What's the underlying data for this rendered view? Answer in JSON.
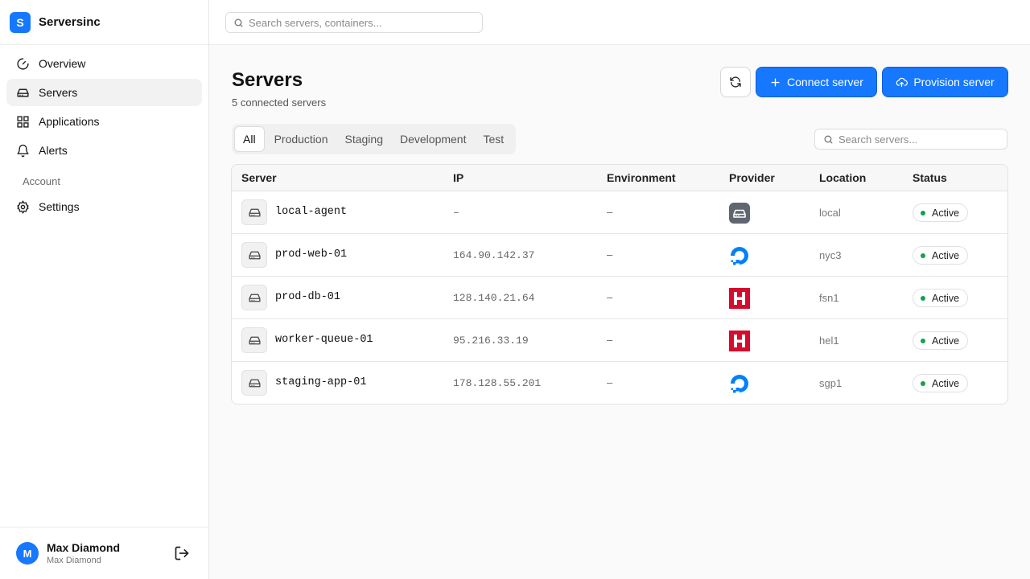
{
  "app": {
    "name": "Serversinc",
    "logo_letter": "S"
  },
  "sidebar": {
    "items": [
      {
        "label": "Overview",
        "icon": "gauge-icon"
      },
      {
        "label": "Servers",
        "icon": "hard-drive-icon"
      },
      {
        "label": "Applications",
        "icon": "grid-icon"
      },
      {
        "label": "Alerts",
        "icon": "bell-icon"
      }
    ],
    "account_label": "Account",
    "account_items": [
      {
        "label": "Settings",
        "icon": "gear-icon"
      }
    ]
  },
  "user": {
    "initial": "M",
    "name": "Max Diamond",
    "subtitle": "Max Diamond"
  },
  "topbar": {
    "search_placeholder": "Search servers, containers..."
  },
  "page": {
    "title": "Servers",
    "subtitle": "5 connected servers",
    "connect_label": "Connect server",
    "provision_label": "Provision server"
  },
  "tabs": [
    "All",
    "Production",
    "Staging",
    "Development",
    "Test"
  ],
  "active_tab": "All",
  "table": {
    "search_placeholder": "Search servers...",
    "columns": [
      "Server",
      "IP",
      "Environment",
      "Provider",
      "Location",
      "Status"
    ],
    "rows": [
      {
        "server": "local-agent",
        "ip": "–",
        "environment": "–",
        "provider": "local-icon",
        "location": "local",
        "status": "Active"
      },
      {
        "server": "prod-web-01",
        "ip": "164.90.142.37",
        "environment": "–",
        "provider": "digitalocean-icon",
        "location": "nyc3",
        "status": "Active"
      },
      {
        "server": "prod-db-01",
        "ip": "128.140.21.64",
        "environment": "–",
        "provider": "hetzner-icon",
        "location": "fsn1",
        "status": "Active"
      },
      {
        "server": "worker-queue-01",
        "ip": "95.216.33.19",
        "environment": "–",
        "provider": "hetzner-icon",
        "location": "hel1",
        "status": "Active"
      },
      {
        "server": "staging-app-01",
        "ip": "178.128.55.201",
        "environment": "–",
        "provider": "digitalocean-icon",
        "location": "sgp1",
        "status": "Active"
      }
    ]
  },
  "colors": {
    "accent": "#1677ff",
    "status_active": "#12a150",
    "hetzner": "#d50c2d",
    "digitalocean": "#0080ff"
  }
}
